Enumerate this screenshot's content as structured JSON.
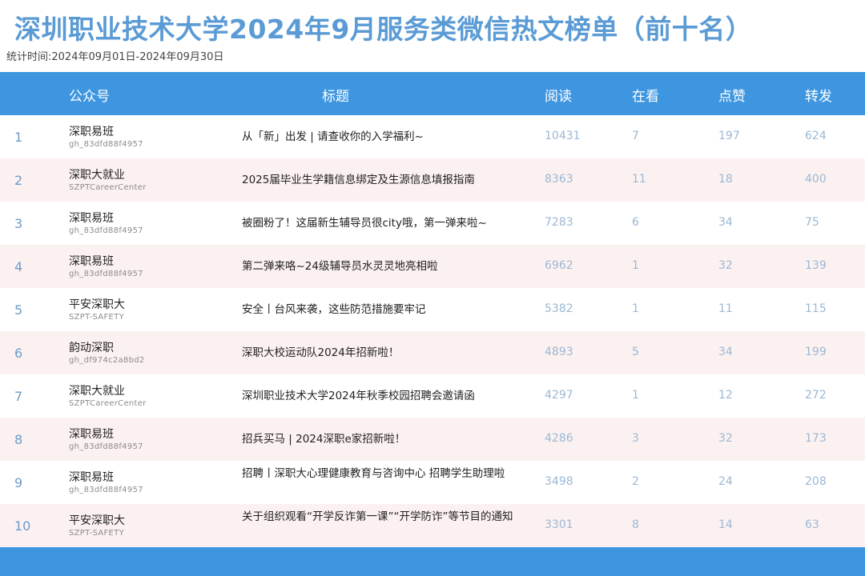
{
  "title": "深圳职业技术大学2024年9月服务类微信热文榜单（前十名）",
  "subtitle": "统计时间:2024年09月01日-2024年09月30日",
  "header": {
    "account": "公众号",
    "title": "标题",
    "read": "阅读",
    "watching": "在看",
    "like": "点赞",
    "share": "转发"
  },
  "rows": [
    {
      "rank": "1",
      "account": "深职易班",
      "account_id": "gh_83dfd88f4957",
      "title": "从「新」出发 | 请查收你的入学福利~",
      "read": "10431",
      "watching": "7",
      "like": "197",
      "share": "624"
    },
    {
      "rank": "2",
      "account": "深职大就业",
      "account_id": "SZPTCareerCenter",
      "title": "2025届毕业生学籍信息绑定及生源信息填报指南",
      "read": "8363",
      "watching": "11",
      "like": "18",
      "share": "400"
    },
    {
      "rank": "3",
      "account": "深职易班",
      "account_id": "gh_83dfd88f4957",
      "title": "被圈粉了！这届新生辅导员很city哦，第一弹来啦~",
      "read": "7283",
      "watching": "6",
      "like": "34",
      "share": "75"
    },
    {
      "rank": "4",
      "account": "深职易班",
      "account_id": "gh_83dfd88f4957",
      "title": "第二弹来咯~24级辅导员水灵灵地亮相啦",
      "read": "6962",
      "watching": "1",
      "like": "32",
      "share": "139"
    },
    {
      "rank": "5",
      "account": "平安深职大",
      "account_id": "SZPT-SAFETY",
      "title": "安全丨台风来袭，这些防范措施要牢记",
      "read": "5382",
      "watching": "1",
      "like": "11",
      "share": "115"
    },
    {
      "rank": "6",
      "account": "韵动深职",
      "account_id": "gh_df974c2a8bd2",
      "title": "深职大校运动队2024年招新啦！",
      "read": "4893",
      "watching": "5",
      "like": "34",
      "share": "199"
    },
    {
      "rank": "7",
      "account": "深职大就业",
      "account_id": "SZPTCareerCenter",
      "title": "深圳职业技术大学2024年秋季校园招聘会邀请函",
      "read": "4297",
      "watching": "1",
      "like": "12",
      "share": "272"
    },
    {
      "rank": "8",
      "account": "深职易班",
      "account_id": "gh_83dfd88f4957",
      "title": "招兵买马 | 2024深职e家招新啦！",
      "read": "4286",
      "watching": "3",
      "like": "32",
      "share": "173"
    },
    {
      "rank": "9",
      "account": "深职易班",
      "account_id": "gh_83dfd88f4957",
      "title": "招聘丨深职大心理健康教育与咨询中心 招聘学生助理啦",
      "read": "3498",
      "watching": "2",
      "like": "24",
      "share": "208"
    },
    {
      "rank": "10",
      "account": "平安深职大",
      "account_id": "SZPT-SAFETY",
      "title": "关于组织观看“开学反诈第一课”“开学防诈”等节目的通知",
      "read": "3301",
      "watching": "8",
      "like": "14",
      "share": "63"
    }
  ]
}
